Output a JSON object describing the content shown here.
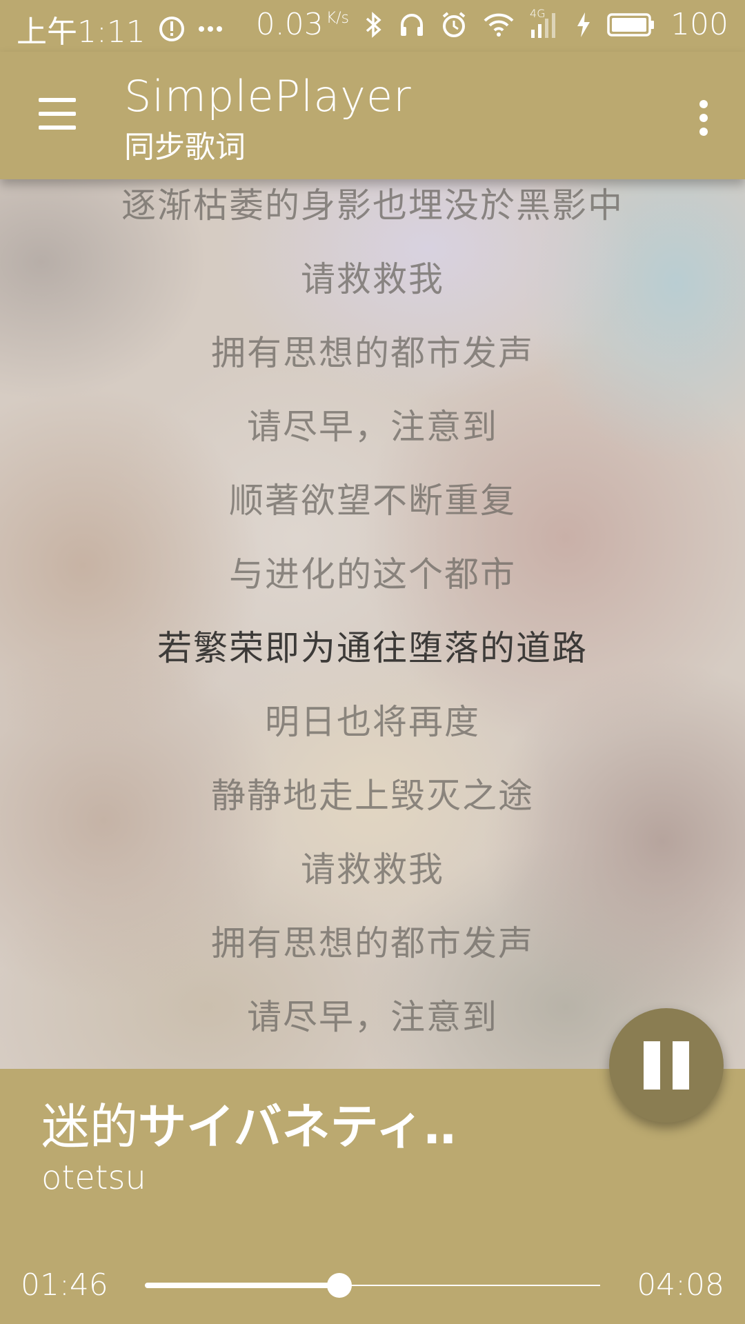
{
  "status_bar": {
    "time": "上午1:11",
    "network_speed": "0.03",
    "network_speed_unit": "K/s",
    "network_type": "4G",
    "battery": "100",
    "icons": [
      "alert-circle-icon",
      "more-dots-icon",
      "bluetooth-icon",
      "headphones-icon",
      "alarm-icon",
      "wifi-icon",
      "signal-icon",
      "charging-icon",
      "battery-icon"
    ]
  },
  "app_bar": {
    "title": "SimplePlayer",
    "subtitle": "同步歌词"
  },
  "lyrics": {
    "lines": [
      "逐渐枯萎的身影也埋没於黑影中",
      "请救救我",
      "拥有思想的都市发声",
      "请尽早，注意到",
      "顺著欲望不断重复",
      "与进化的这个都市",
      "若繁荣即为通往堕落的道路",
      "明日也将再度",
      "静静地走上毁灭之途",
      "请救救我",
      "拥有思想的都市发声",
      "请尽早，注意到"
    ],
    "active_index": 6
  },
  "now_playing": {
    "title_prefix": "迷的",
    "title_rest": "サイバネティ‥",
    "artist": "otetsu",
    "elapsed": "01:46",
    "total": "04:08",
    "progress": 0.427
  },
  "colors": {
    "accent": "#bba970",
    "fab": "#8a7d52"
  }
}
